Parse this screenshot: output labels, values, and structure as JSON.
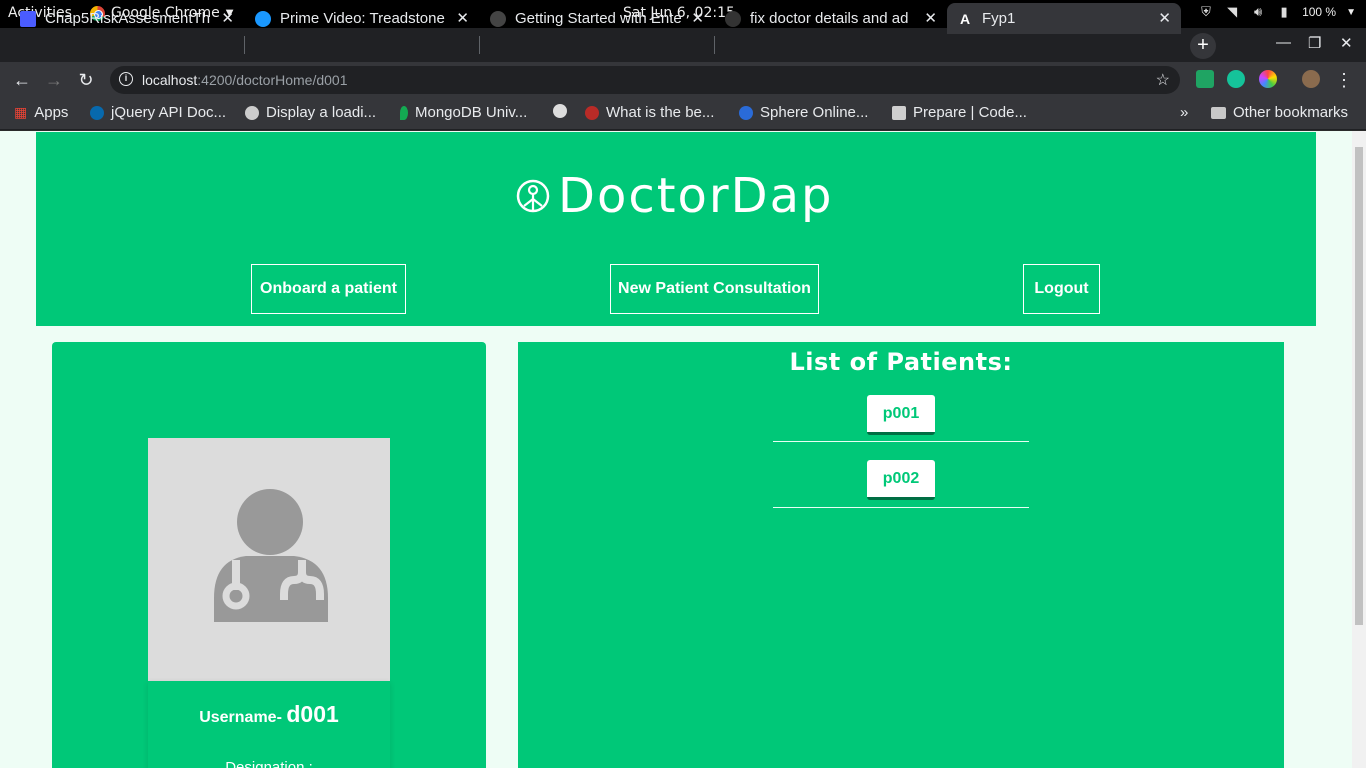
{
  "system_bar": {
    "activities": "Activities",
    "app_name": "Google Chrome",
    "clock": "Sat Jun  6, 02:15",
    "battery": "100 %"
  },
  "browser": {
    "tabs": [
      {
        "title": "Chap5RiskAssesmentTh",
        "favicon_color": "#4a5cff"
      },
      {
        "title": "Prime Video: Treadstone",
        "favicon_color": "#1a98ff"
      },
      {
        "title": "Getting Started with Ente",
        "favicon_color": "#444444"
      },
      {
        "title": "fix doctor details and ad",
        "favicon_color": "#333333"
      },
      {
        "title": "Fyp1",
        "favicon_color": "#dd0031",
        "active": true
      }
    ],
    "url_host": "localhost",
    "url_rest": ":4200/doctorHome/d001",
    "bookmarks": [
      {
        "label": "Apps",
        "color": "#ea4335"
      },
      {
        "label": "jQuery API Doc...",
        "color": "#0769ad"
      },
      {
        "label": "Display a loadi...",
        "color": "#cccccc"
      },
      {
        "label": "MongoDB Univ...",
        "color": "#13aa52"
      },
      {
        "label": "",
        "color": "#dddddd"
      },
      {
        "label": "What is the be...",
        "color": "#b92b27"
      },
      {
        "label": "Sphere Online...",
        "color": "#2a6bd8"
      },
      {
        "label": "Prepare | Code...",
        "color": "#cfcfcf"
      }
    ],
    "other_bookmarks": "Other bookmarks",
    "overflow": "»"
  },
  "page": {
    "brand": "DoctorDap",
    "nav": {
      "onboard": "Onboard a patient",
      "consult": "New Patient Consultation",
      "logout": "Logout"
    },
    "profile": {
      "username_label": "Username-",
      "username_value": "d001",
      "designation_label": "Designation :"
    },
    "patients": {
      "title": "List of Patients:",
      "items": [
        "p001",
        "p002"
      ]
    },
    "accent_color": "#00c878"
  }
}
